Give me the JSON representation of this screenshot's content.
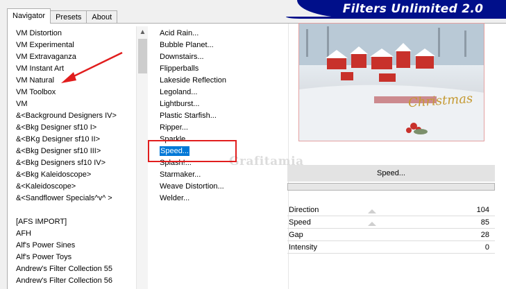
{
  "tabs": [
    {
      "label": "Navigator",
      "active": true
    },
    {
      "label": "Presets",
      "active": false
    },
    {
      "label": "About",
      "active": false
    }
  ],
  "banner": {
    "title": "Filters Unlimited 2.0",
    "color": "#000f8a"
  },
  "categories": [
    "VM Distortion",
    "VM Experimental",
    "VM Extravaganza",
    "VM Instant Art",
    "VM Natural",
    "VM Toolbox",
    "VM",
    "&<Background Designers IV>",
    "&<Bkg Designer sf10 I>",
    "&<BKg Designer sf10 II>",
    "&<Bkg Designer sf10 III>",
    "&<Bkg Designers sf10 IV>",
    "&<Bkg Kaleidoscope>",
    "&<Kaleidoscope>",
    "&<Sandflower Specials^v^ >",
    "",
    "[AFS IMPORT]",
    "AFH",
    "Alf's Power Sines",
    "Alf's Power Toys",
    "Andrew's Filter Collection 55",
    "Andrew's Filter Collection 56"
  ],
  "filters": [
    "Acid Rain...",
    "Bubble Planet...",
    "Downstairs...",
    "Flipperballs",
    "Lakeside Reflection",
    "Legoland...",
    "Lightburst...",
    "Plastic Starfish...",
    "Ripper...",
    "Sparkle",
    "Speed...",
    "Splash!...",
    "Starmaker...",
    "Weave Distortion...",
    "Welder..."
  ],
  "selected_filter": "Speed...",
  "preview": {
    "watermark": "Grafitamia",
    "image_text": "Christmas"
  },
  "filter_name": "Speed...",
  "params": [
    {
      "label": "Direction",
      "value": "104"
    },
    {
      "label": "Speed",
      "value": "85"
    },
    {
      "label": "Gap",
      "value": "28"
    },
    {
      "label": "Intensity",
      "value": "0"
    }
  ],
  "annotation_color": "#e11d1d",
  "selection_color": "#0078d7"
}
